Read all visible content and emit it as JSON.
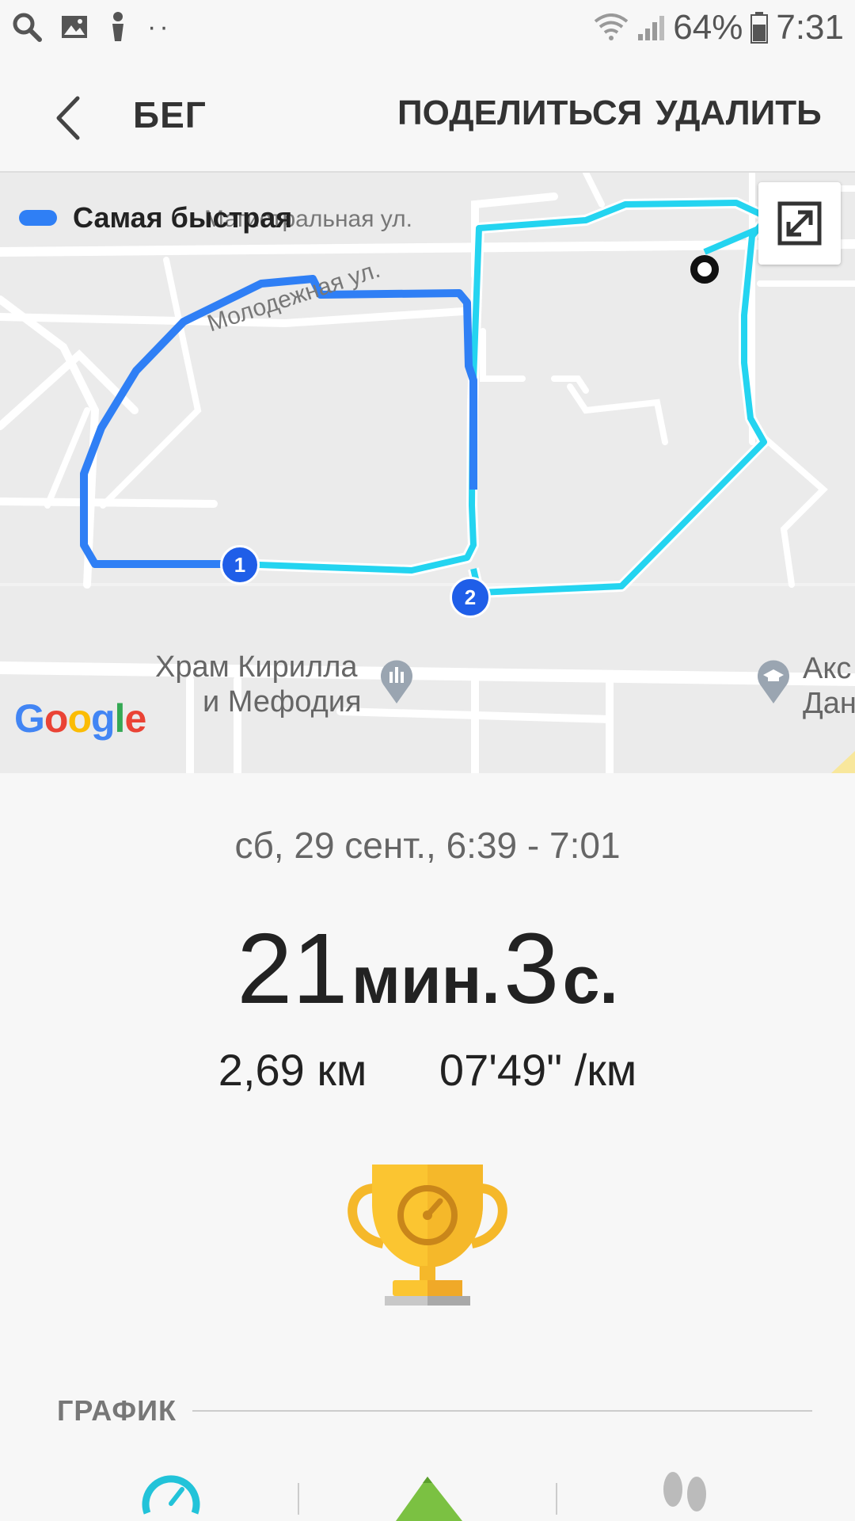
{
  "status_bar": {
    "battery": "64%",
    "time": "7:31"
  },
  "app_bar": {
    "title": "БЕГ",
    "share_label": "ПОДЕЛИТЬСЯ",
    "delete_label": "УДАЛИТЬ"
  },
  "map": {
    "legend_label": "Самая быстрая",
    "street_1": "Магистральная ул.",
    "street_2": "Молодежная ул.",
    "place_1_line1": "Храм Кирилла",
    "place_1_line2": "и Мефодия",
    "place_2_line1": "Акс",
    "place_2_line2": "Дан",
    "marker_1": "1",
    "marker_2": "2",
    "google": "Google",
    "colors": {
      "fastest": "#2f7ff5",
      "route": "#24d4f0"
    }
  },
  "workout": {
    "datetime": "сб, 29 сент., 6:39 - 7:01",
    "minutes": "21",
    "minutes_unit": "мин.",
    "seconds": "3",
    "seconds_unit": "с.",
    "distance": "2,69 км",
    "pace": "07'49\" /км"
  },
  "section": {
    "graph_title": "ГРАФИК"
  },
  "icons": [
    "search-icon",
    "image-icon",
    "person-icon",
    "wifi-icon",
    "signal-icon",
    "battery-icon",
    "back-icon",
    "expand-icon",
    "trophy-icon",
    "speed-icon",
    "elevation-icon",
    "steps-icon"
  ]
}
